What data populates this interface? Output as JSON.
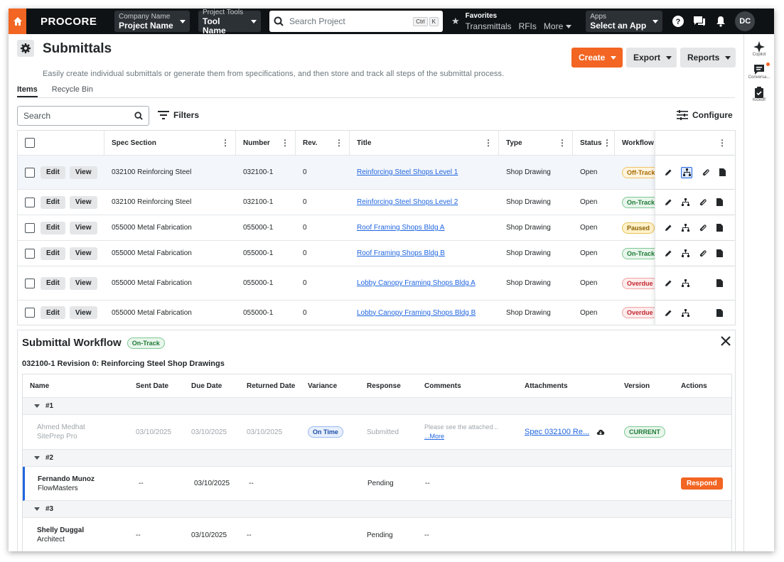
{
  "topbar": {
    "logo": "PROCORE",
    "company_small": "Company Name",
    "company_big": "Project Name",
    "tools_small": "Project Tools",
    "tools_big": "Tool Name",
    "search_placeholder": "Search Project",
    "kbd1": "Ctrl",
    "kbd2": "K",
    "favorites_label": "Favorites",
    "fav_links": [
      "Transmittals",
      "RFIs",
      "More"
    ],
    "apps_small": "Apps",
    "apps_big": "Select an App",
    "avatar": "DC"
  },
  "right_sidebar": [
    "Copilot",
    "Conversa...",
    "Kickoff"
  ],
  "page": {
    "title": "Submittals",
    "description": "Easily create individual submittals or generate them from specifications, and then store and track all steps of the submittal process.",
    "create": "Create",
    "export": "Export",
    "reports": "Reports",
    "tabs": [
      "Items",
      "Recycle Bin"
    ],
    "search_placeholder": "Search",
    "filters": "Filters",
    "configure": "Configure"
  },
  "grid": {
    "columns": [
      "Spec Section",
      "Number",
      "Rev.",
      "Title",
      "Type",
      "Status",
      "Workflow"
    ],
    "edit": "Edit",
    "view": "View",
    "rows": [
      {
        "spec": "032100 Reinforcing Steel",
        "number": "032100-1",
        "rev": "0",
        "title": "Reinforcing Steel Shops Level 1",
        "type": "Shop Drawing",
        "status": "Open",
        "workflow": "Off-Track"
      },
      {
        "spec": "032100 Reinforcing Steel",
        "number": "032100-1",
        "rev": "0",
        "title": "Reinforcing Steel Shops Level 2",
        "type": "Shop Drawing",
        "status": "Open",
        "workflow": "On-Track"
      },
      {
        "spec": "055000 Metal Fabrication",
        "number": "055000-1",
        "rev": "0",
        "title": "Roof Framing Shops Bldg A",
        "type": "Shop Drawing",
        "status": "Open",
        "workflow": "Paused"
      },
      {
        "spec": "055000 Metal Fabrication",
        "number": "055000-1",
        "rev": "0",
        "title": "Roof Framing Shops Bldg B",
        "type": "Shop Drawing",
        "status": "Open",
        "workflow": "On-Track"
      },
      {
        "spec": "055000 Metal Fabrication",
        "number": "055000-1",
        "rev": "0",
        "title": "Lobby Canopy Framing Shops Bldg A",
        "type": "Shop Drawing",
        "status": "Open",
        "workflow": "Overdue"
      },
      {
        "spec": "055000 Metal Fabrication",
        "number": "055000-1",
        "rev": "0",
        "title": "Lobby Canopy Framing Shops Bldg B",
        "type": "Shop Drawing",
        "status": "Open",
        "workflow": "Overdue"
      }
    ]
  },
  "workflow": {
    "title": "Submittal Workflow",
    "badge": "On-Track",
    "subtitle": "032100-1 Revision 0: Reinforcing Steel Shop Drawings",
    "columns": [
      "Name",
      "Sent Date",
      "Due Date",
      "Returned Date",
      "Variance",
      "Response",
      "Comments",
      "Attachments",
      "Version",
      "Actions"
    ],
    "groups": [
      "#1",
      "#2",
      "#3"
    ],
    "r1": {
      "name": "Ahmed Medhat",
      "company": "SitePrep Pro",
      "sent": "03/10/2025",
      "due": "03/10/2025",
      "returned": "03/10/2025",
      "variance": "On Time",
      "response": "Submitted",
      "comment": "Please see the attached...",
      "more": "...More",
      "attachment": "Spec 032100 Re...",
      "version": "CURRENT"
    },
    "r2": {
      "name": "Fernando Munoz",
      "company": "FlowMasters",
      "sent": "--",
      "due": "03/10/2025",
      "returned": "--",
      "response": "Pending",
      "comment": "--",
      "action": "Respond"
    },
    "r3": {
      "name": "Shelly Duggal",
      "company": "Architect",
      "sent": "--",
      "due": "03/10/2025",
      "returned": "--",
      "response": "Pending",
      "comment": "--"
    }
  }
}
